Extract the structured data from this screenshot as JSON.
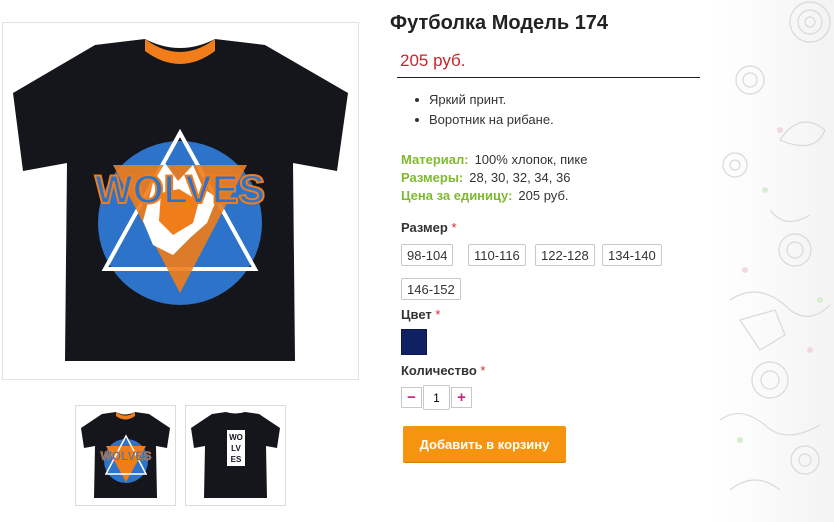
{
  "product": {
    "title": "Футболка Модель 174",
    "price": "205 руб.",
    "features": [
      "Яркий принт.",
      "Воротник на рибане."
    ],
    "specs": [
      {
        "label": "Материал:",
        "value": "100% хлопок, пике"
      },
      {
        "label": "Размеры:",
        "value": "28, 30, 32, 34, 36"
      },
      {
        "label": "Цена за единицу:",
        "value": "205 руб."
      }
    ],
    "front_print_text": "WOLVES",
    "back_print_letters": [
      "WO",
      "LV",
      "ES"
    ]
  },
  "options": {
    "size_label": "Размер",
    "required_mark": "*",
    "sizes": [
      "98-104",
      "110-116",
      "122-128",
      "134-140",
      "146-152"
    ],
    "color_label": "Цвет",
    "color_value": "#0f2063",
    "qty_label": "Количество",
    "qty_minus": "−",
    "qty_plus": "+",
    "quantity": "1"
  },
  "cart_button": "Добавить в корзину",
  "colors": {
    "price": "#c3252c",
    "spec_label": "#7fba2e",
    "required": "#d9272e",
    "button": "#f7940f",
    "shirt": "#14161c",
    "print_orange": "#f07d1a",
    "print_blue": "#2d73c9"
  }
}
